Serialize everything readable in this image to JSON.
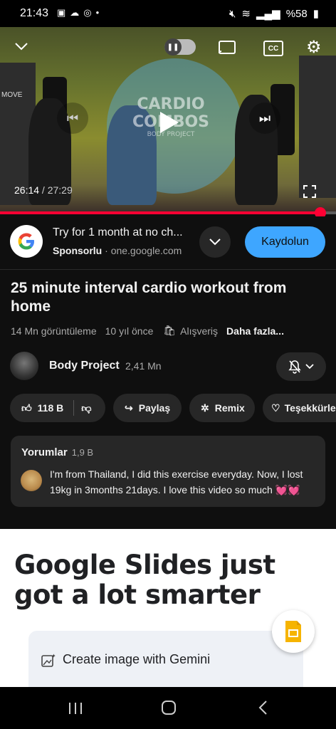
{
  "status_bar": {
    "time": "21:43",
    "battery": "%58"
  },
  "player": {
    "video_title_overlay": "CARDIO COMBOS",
    "video_title_overlay_sub": "BODY PROJECT",
    "time_current": "26:14",
    "time_separator": " / ",
    "time_total": "27:29",
    "progress_fraction": 0.954,
    "cc_label": "CC",
    "side_label": "MOVE"
  },
  "ad": {
    "title": "Try for 1 month at no ch...",
    "sponsored": "Sponsorlu",
    "dot": "·",
    "url": "one.google.com",
    "cta": "Kaydolun"
  },
  "video": {
    "title": "25 minute interval cardio workout from home",
    "views": "14 Mn görüntüleme",
    "age": "10 yıl önce",
    "shopping": "Alışveriş",
    "more": "Daha fazla..."
  },
  "channel": {
    "name": "Body Project",
    "subscribers": "2,41 Mn"
  },
  "actions": {
    "likes": "118 B",
    "share": "Paylaş",
    "remix": "Remix",
    "thanks": "Teşekkürle"
  },
  "comments": {
    "header": "Yorumlar",
    "count": "1,9 B",
    "top_comment": "I'm from Thailand, I did this exercise everyday. Now, I lost 19kg in 3months 21days. I love this video so much 💓💓"
  },
  "banner": {
    "headline": "Google Slides just got a lot smarter",
    "card_text": "Create image with Gemini"
  },
  "colors": {
    "accent_red": "#ff0033",
    "cta_blue": "#3ea6ff",
    "chip_bg": "#272727"
  }
}
